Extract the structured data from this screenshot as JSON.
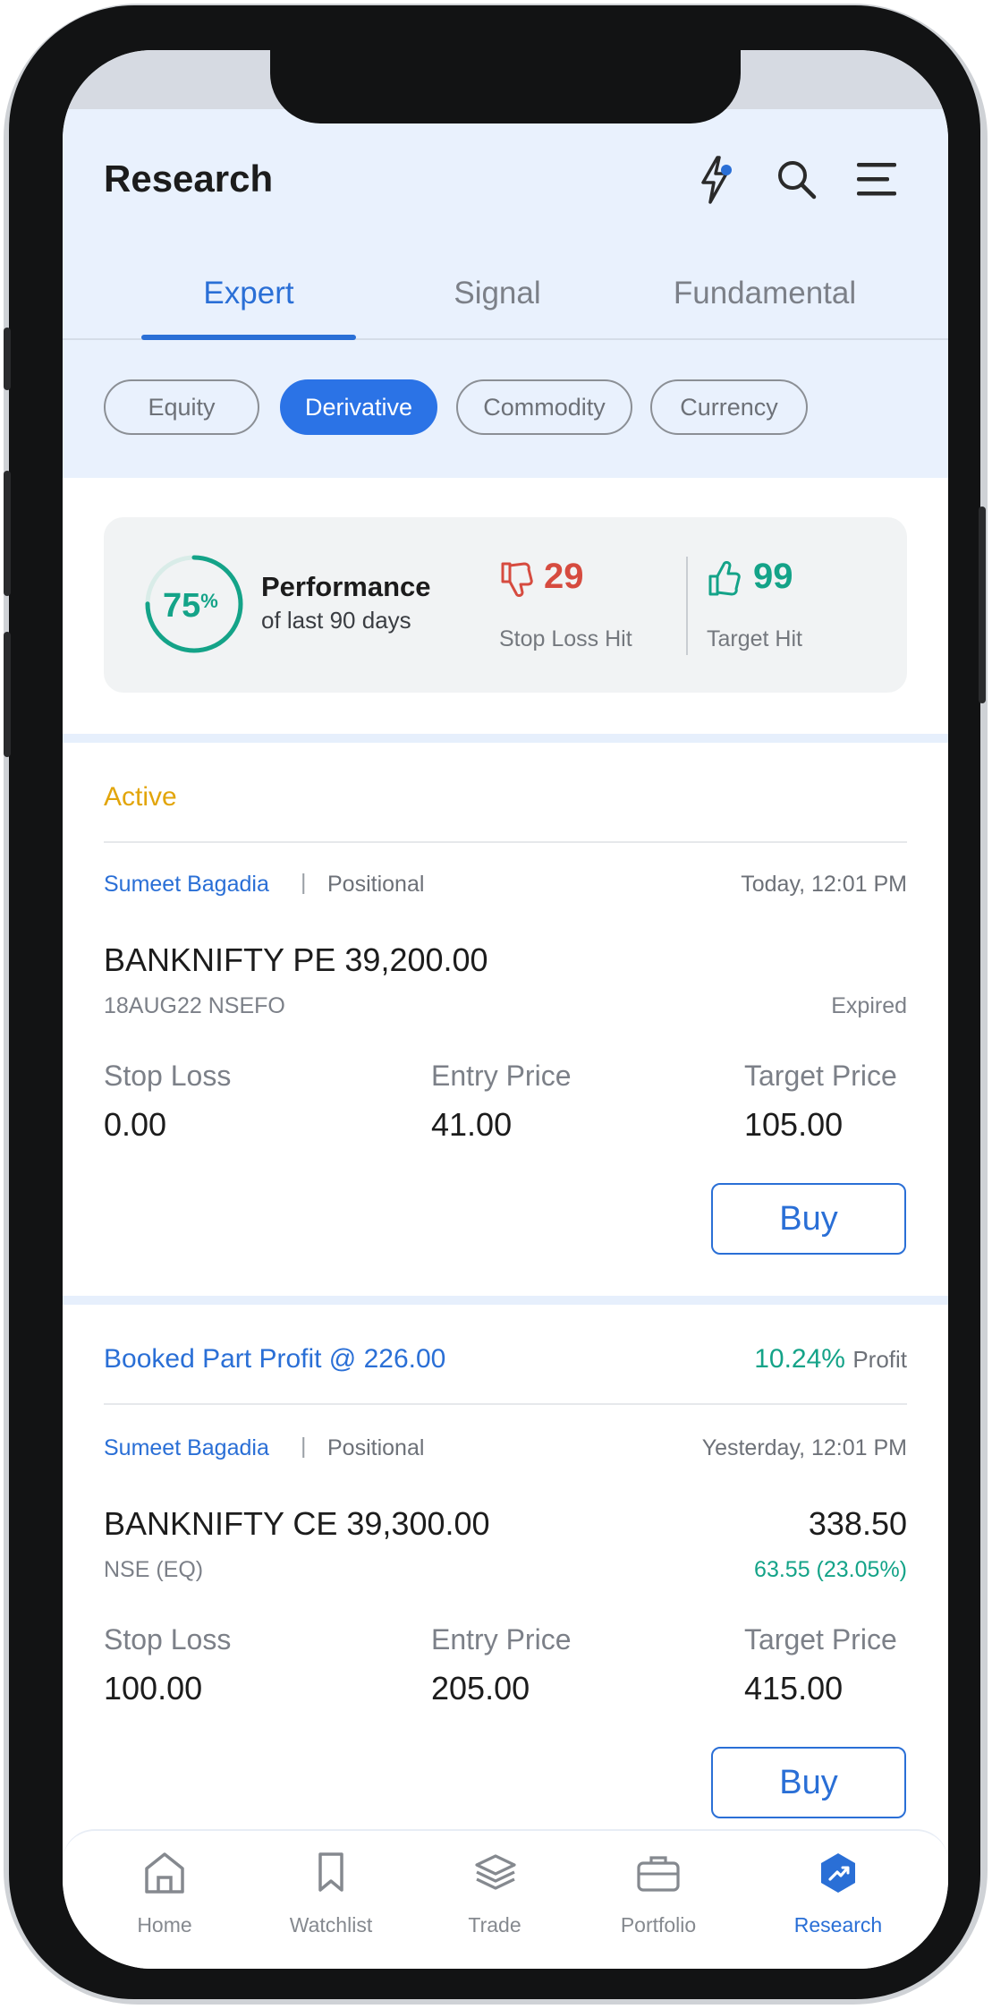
{
  "header": {
    "title": "Research",
    "icons": [
      "flash-icon",
      "search-icon",
      "menu-icon"
    ]
  },
  "tabs": [
    {
      "label": "Expert",
      "active": true
    },
    {
      "label": "Signal",
      "active": false
    },
    {
      "label": "Fundamental",
      "active": false
    }
  ],
  "chips": [
    {
      "label": "Equity",
      "active": false
    },
    {
      "label": "Derivative",
      "active": true
    },
    {
      "label": "Commodity",
      "active": false
    },
    {
      "label": "Currency",
      "active": false
    }
  ],
  "performance": {
    "percent_value": "75",
    "percent_sign": "%",
    "progress": 0.75,
    "title": "Performance",
    "subtitle": "of last 90 days",
    "stop_loss_count": "29",
    "stop_loss_label": "Stop Loss Hit",
    "target_count": "99",
    "target_label": "Target Hit"
  },
  "cards": [
    {
      "status": "Active",
      "analyst": "Sumeet Bagadia",
      "separator": "|",
      "type": "Positional",
      "time": "Today, 12:01 PM",
      "instrument": "BANKNIFTY PE 39,200.00",
      "sub": "18AUG22 NSEFO",
      "right_note": "Expired",
      "stop_loss_label": "Stop Loss",
      "stop_loss": "0.00",
      "entry_label": "Entry Price",
      "entry": "41.00",
      "target_label": "Target Price",
      "target": "105.00",
      "action": "Buy"
    },
    {
      "status": "Booked Part Profit @ 226.00",
      "profit_pct": "10.24%",
      "profit_label": "Profit",
      "analyst": "Sumeet Bagadia",
      "separator": "|",
      "type": "Positional",
      "time": "Yesterday, 12:01 PM",
      "instrument": "BANKNIFTY CE 39,300.00",
      "sub": "NSE (EQ)",
      "ltp": "338.50",
      "change": "63.55 (23.05%)",
      "stop_loss_label": "Stop Loss",
      "stop_loss": "100.00",
      "entry_label": "Entry Price",
      "entry": "205.00",
      "target_label": "Target Price",
      "target": "415.00",
      "action": "Buy"
    }
  ],
  "nav": [
    {
      "label": "Home",
      "icon": "home-icon",
      "active": false
    },
    {
      "label": "Watchlist",
      "icon": "bookmark-icon",
      "active": false
    },
    {
      "label": "Trade",
      "icon": "layers-icon",
      "active": false
    },
    {
      "label": "Portfolio",
      "icon": "briefcase-icon",
      "active": false
    },
    {
      "label": "Research",
      "icon": "research-icon",
      "active": true
    }
  ],
  "colors": {
    "accent": "#2a6fd6",
    "green": "#14a388",
    "red": "#d64b3f",
    "active_status": "#e2a50a"
  }
}
